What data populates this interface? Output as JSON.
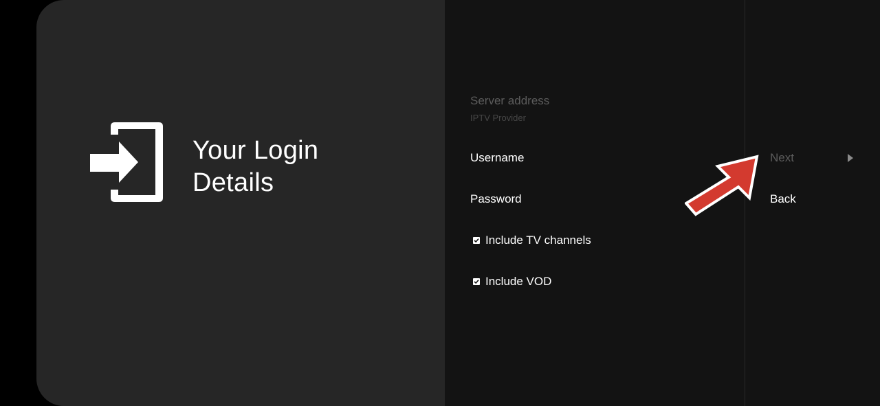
{
  "header": {
    "title_line1": "Your Login",
    "title_line2": "Details"
  },
  "form": {
    "server_address_label": "Server address",
    "server_address_value": "IPTV Provider",
    "username_label": "Username",
    "password_label": "Password",
    "include_tv_label": "Include TV channels",
    "include_tv_checked": true,
    "include_vod_label": "Include VOD",
    "include_vod_checked": true
  },
  "actions": {
    "next_label": "Next",
    "back_label": "Back"
  },
  "icons": {
    "login": "login-icon",
    "chevron": "chevron-right-icon",
    "annotation": "red-arrow-icon"
  },
  "colors": {
    "left_panel_bg": "#262626",
    "right_panel_bg": "#131313",
    "annotation_arrow": "#d33a2f",
    "disabled_text": "#5c5c5c"
  }
}
